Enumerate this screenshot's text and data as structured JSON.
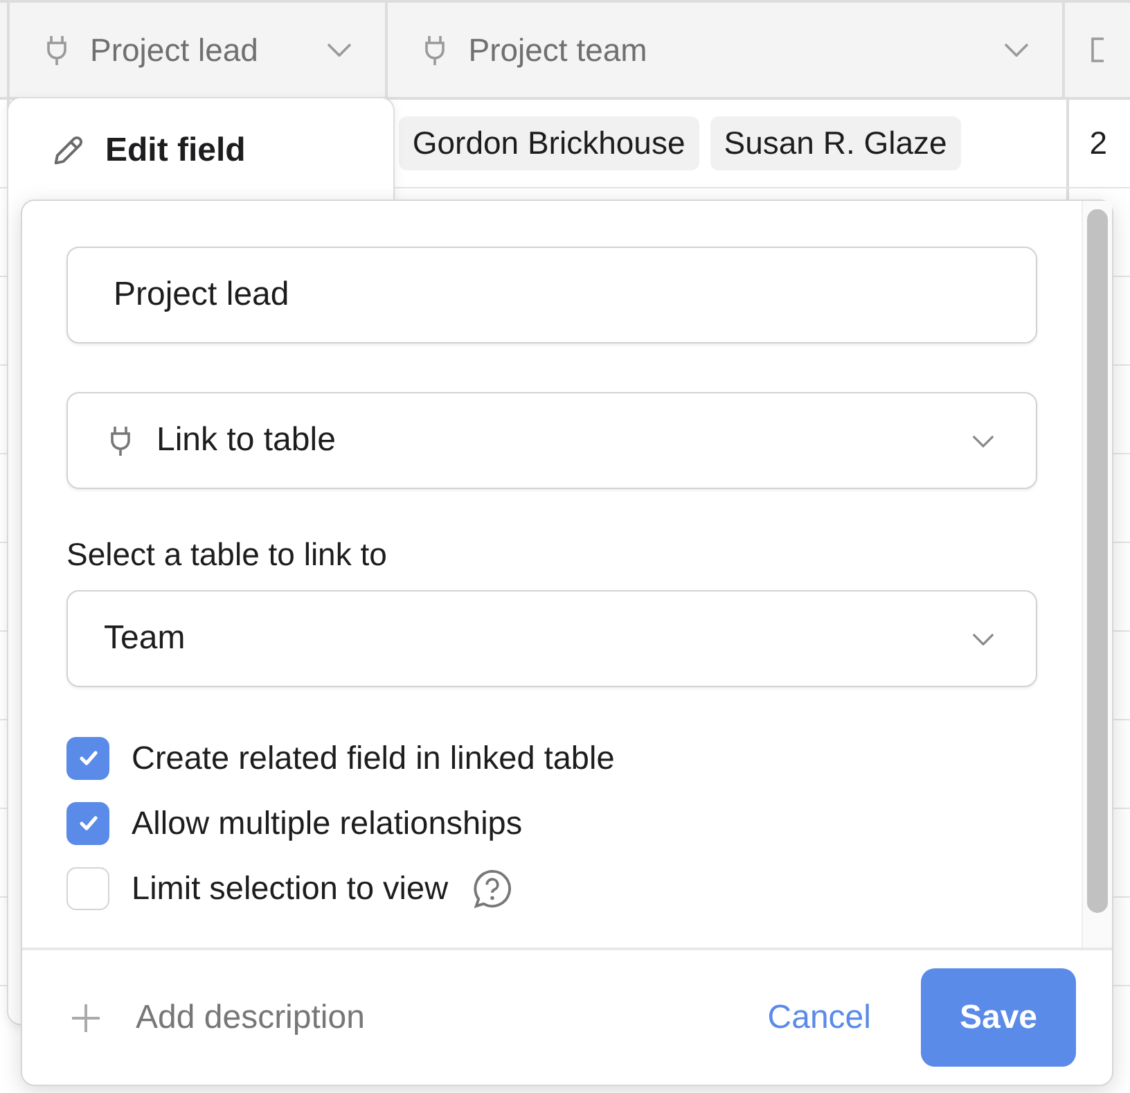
{
  "table": {
    "columns": [
      {
        "label": "Project lead"
      },
      {
        "label": "Project team"
      }
    ],
    "rows": [
      {
        "project_team": [
          "Gordon Brickhouse",
          "Susan R. Glaze"
        ],
        "column_3": "2"
      }
    ]
  },
  "menu": {
    "items": [
      {
        "label": "Edit field"
      }
    ]
  },
  "dialog": {
    "name_field": {
      "value": "Project lead"
    },
    "type_select": {
      "value": "Link to table"
    },
    "table_label": "Select a table to link to",
    "table_select": {
      "value": "Team"
    },
    "options": [
      {
        "label": "Create related field in linked table",
        "checked": true,
        "help": false
      },
      {
        "label": "Allow multiple relationships",
        "checked": true,
        "help": false
      },
      {
        "label": "Limit selection to view",
        "checked": false,
        "help": true
      }
    ],
    "footer": {
      "add_description": "Add description",
      "cancel": "Cancel",
      "save": "Save"
    }
  }
}
